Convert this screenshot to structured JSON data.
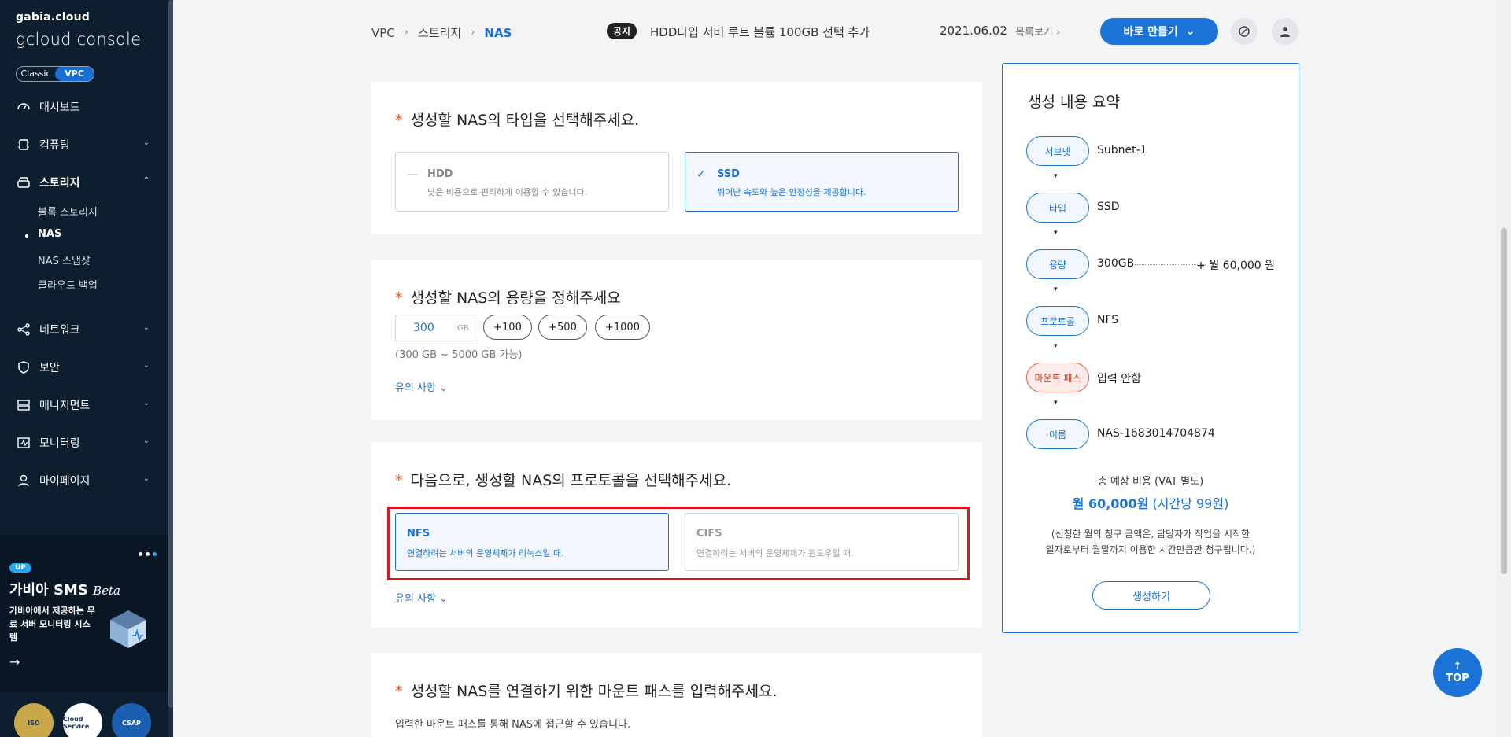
{
  "sidebar": {
    "brand_top": "gabia.cloud",
    "brand_main": "gcloud console",
    "mode_classic": "Classic",
    "mode_vpc": "VPC",
    "items": [
      {
        "label": "대시보드"
      },
      {
        "label": "컴퓨팅"
      },
      {
        "label": "스토리지"
      },
      {
        "label": "네트워크"
      },
      {
        "label": "보안"
      },
      {
        "label": "매니지먼트"
      },
      {
        "label": "모니터링"
      },
      {
        "label": "마이페이지"
      }
    ],
    "storage_sub": [
      "블록 스토리지",
      "NAS",
      "NAS 스냅샷",
      "클라우드 백업"
    ],
    "promo": {
      "badge": "UP",
      "title": "가비아 SMS",
      "beta": "Beta",
      "desc": "가비아에서 제공하는 무료 서버 모니터링 시스템"
    },
    "certs": [
      "ISO",
      "Cloud Service",
      "CSAP"
    ]
  },
  "header": {
    "breadcrumb": [
      "VPC",
      "스토리지",
      "NAS"
    ],
    "notice_tag": "공지",
    "notice_text": "HDD타입 서버 루트 볼륨 100GB 선택 추가",
    "notice_date": "2021.06.02",
    "notice_more": "목록보기",
    "create_button": "바로 만들기"
  },
  "type_section": {
    "title": "생성할 NAS의 타입을 선택해주세요.",
    "options": [
      {
        "name": "HDD",
        "desc": "낮은 비용으로 편리하게 이용할 수 있습니다.",
        "selected": false
      },
      {
        "name": "SSD",
        "desc": "뛰어난 속도와 높은 안정성을 제공합니다.",
        "selected": true
      }
    ]
  },
  "capacity_section": {
    "title": "생성할 NAS의 용량을 정해주세요",
    "value": "300",
    "unit": "GB",
    "increments": [
      "+100",
      "+500",
      "+1000"
    ],
    "range": "(300 GB ~ 5000 GB 가능)",
    "notes": "유의 사항"
  },
  "protocol_section": {
    "title": "다음으로, 생성할 NAS의 프로토콜을 선택해주세요.",
    "options": [
      {
        "name": "NFS",
        "desc": "연결하려는 서버의 운영체제가 리눅스일 때.",
        "selected": true
      },
      {
        "name": "CIFS",
        "desc": "연결하려는 서버의 운영체제가 윈도우일 때.",
        "selected": false
      }
    ],
    "notes": "유의 사항"
  },
  "mount_section": {
    "title": "생성할 NAS를 연결하기 위한 마운트 패스를 입력해주세요.",
    "desc": "입력한 마운트 패스를 통해 NAS에 접근할 수 있습니다."
  },
  "summary": {
    "title": "생성 내용 요약",
    "steps": [
      {
        "label": "서브넷",
        "value": "Subnet-1"
      },
      {
        "label": "타입",
        "value": "SSD"
      },
      {
        "label": "용량",
        "value": "300GB",
        "price": "+ 월 60,000 원"
      },
      {
        "label": "프로토콜",
        "value": "NFS"
      },
      {
        "label": "마운트 패스",
        "value": "입력 안함"
      },
      {
        "label": "이름",
        "value": "NAS-1683014704874"
      }
    ],
    "cost_label": "총 예상 비용 (VAT 별도)",
    "cost_month": "월 60,000원",
    "cost_hour": "(시간당 99원)",
    "cost_note_1": "(신청한 월의 청구 금액은, 담당자가 작업을 시작한",
    "cost_note_2": "일자로부터 월말까지 이용한 시간만큼만 청구됩니다.)",
    "create_button": "생성하기"
  },
  "top_button": "TOP",
  "colors": {
    "accent": "#1b73d8",
    "sidebar_bg": "#0d1e2e",
    "highlight": "#e0141e",
    "warn": "#d23c2a"
  }
}
